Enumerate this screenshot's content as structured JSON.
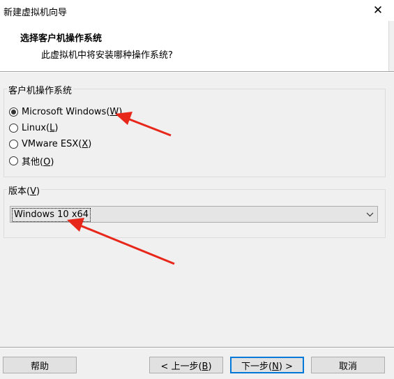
{
  "window": {
    "title": "新建虚拟机向导",
    "close_glyph": "✕"
  },
  "header": {
    "title": "选择客户机操作系统",
    "subtitle": "此虚拟机中将安装哪种操作系统?"
  },
  "guest_os": {
    "group_label": "客户机操作系统",
    "options": [
      {
        "pre": "Microsoft Windows(",
        "key": "W",
        "post": ")",
        "checked": true
      },
      {
        "pre": "Linux(",
        "key": "L",
        "post": ")",
        "checked": false
      },
      {
        "pre": "VMware ESX(",
        "key": "X",
        "post": ")",
        "checked": false
      },
      {
        "pre": "其他(",
        "key": "O",
        "post": ")",
        "checked": false
      }
    ]
  },
  "version": {
    "group_label_pre": "版本(",
    "group_label_key": "V",
    "group_label_post": ")",
    "selected": "Windows 10 x64"
  },
  "buttons": {
    "help": "帮助",
    "back_pre": "< 上一步(",
    "back_key": "B",
    "back_post": ")",
    "next_pre": "下一步(",
    "next_key": "N",
    "next_post": ") >",
    "cancel": "取消"
  },
  "colors": {
    "annotation_arrow": "#e8271b",
    "default_button_border": "#0078d7"
  }
}
